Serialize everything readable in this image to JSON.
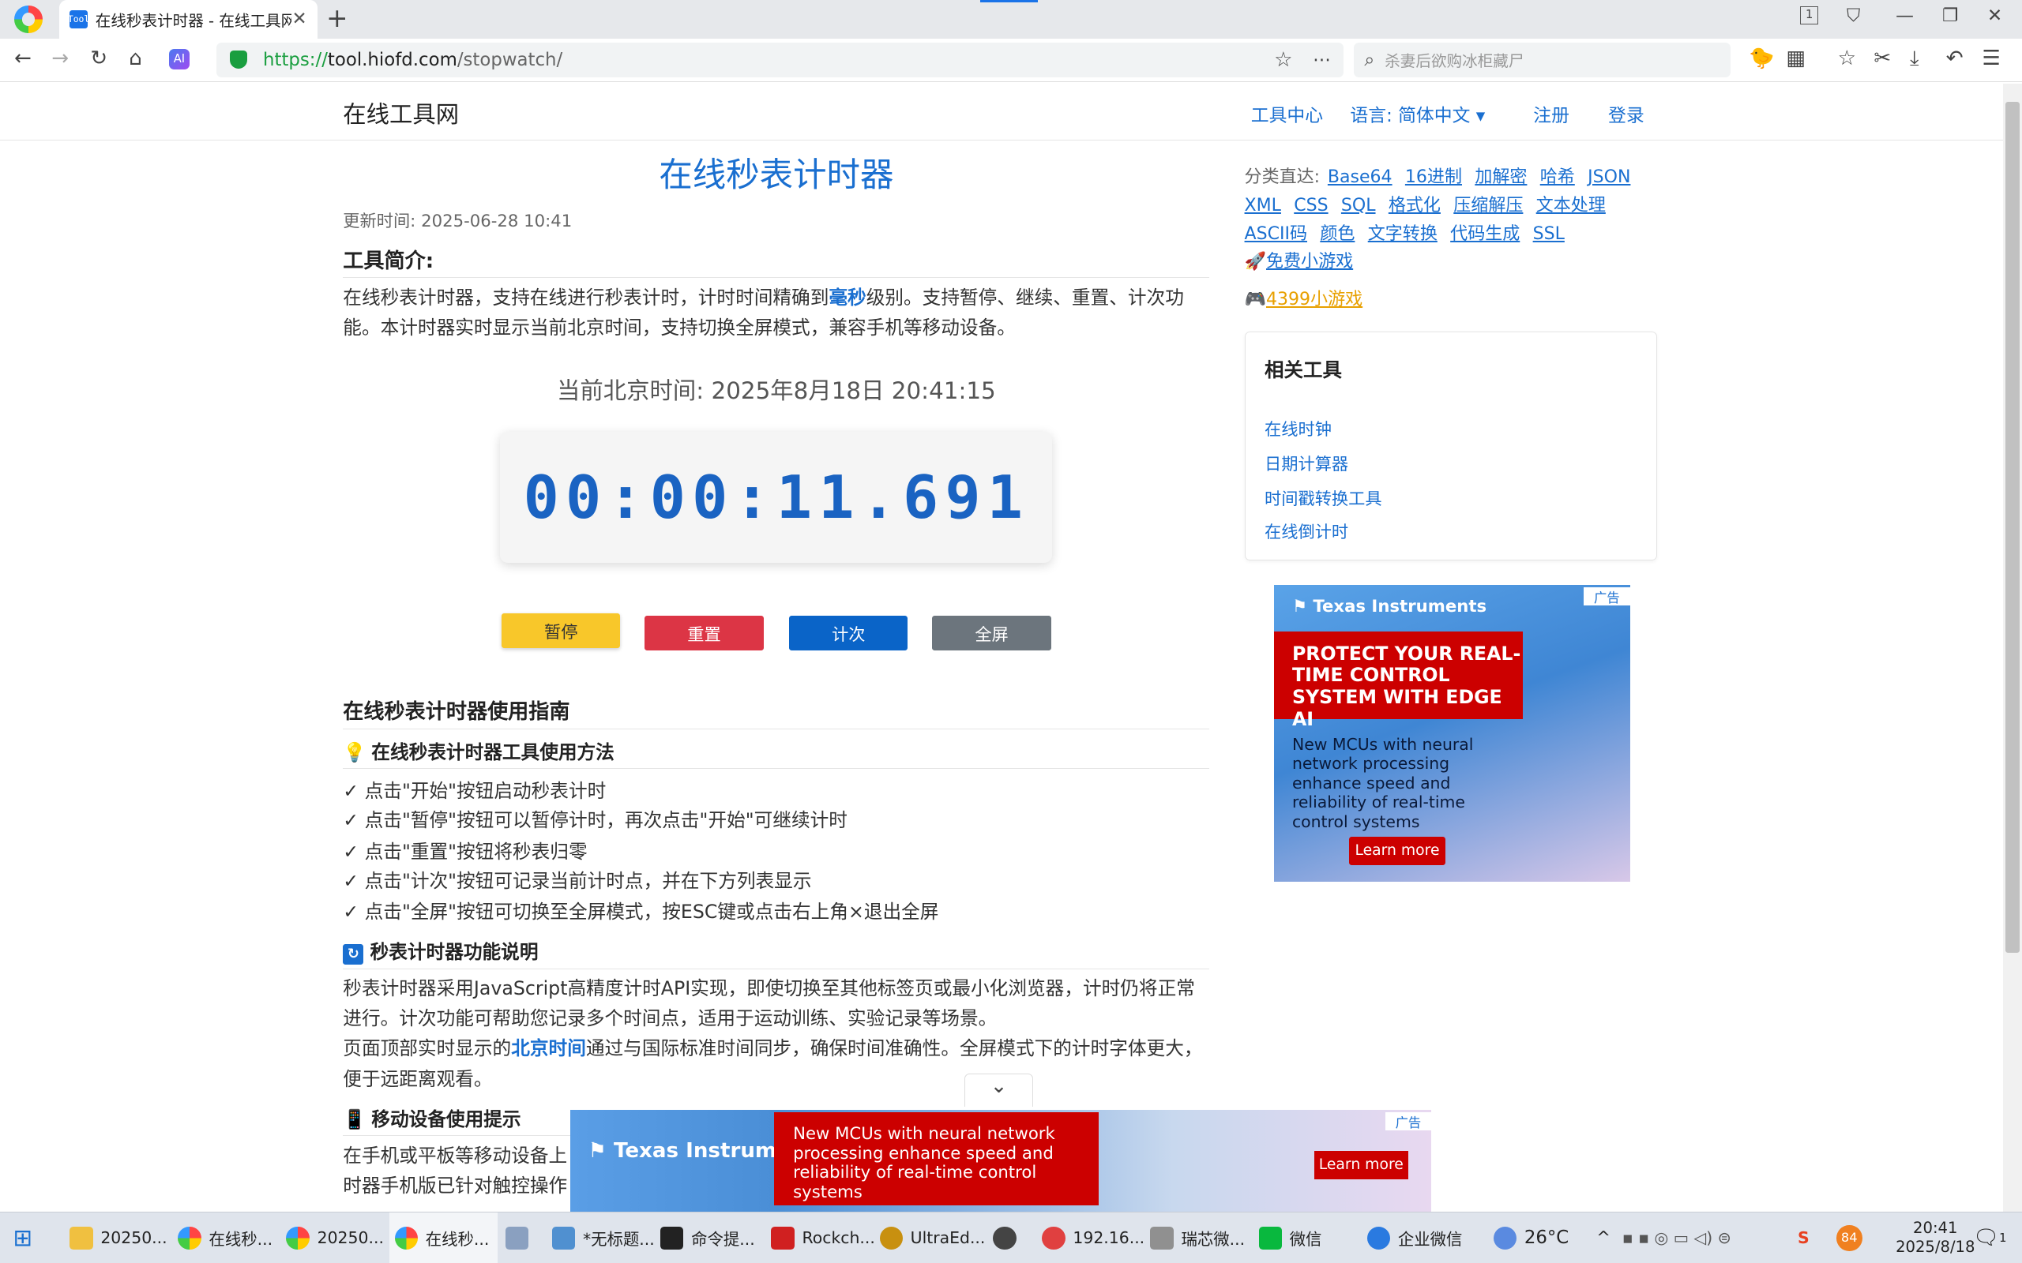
{
  "browser": {
    "tab_title": "在线秒表计时器 - 在线工具网",
    "tab_favicon": "Tool",
    "url_scheme": "https://",
    "url_host": "tool.hiofd.com",
    "url_path": "/stopwatch/",
    "search_placeholder": "杀妻后欲购冰柜藏尸",
    "tab_count": "1"
  },
  "site": {
    "name": "在线工具网",
    "nav": [
      "工具中心",
      "语言: 简体中文 ▾",
      "注册",
      "登录"
    ]
  },
  "main": {
    "title": "在线秒表计时器",
    "updated": "更新时间: 2025-06-28 10:41",
    "intro_heading": "工具简介:",
    "intro_a": "在线秒表计时器，支持在线进行秒表计时，计时时间精确到",
    "intro_bold": "毫秒",
    "intro_b": "级别。支持暂停、继续、重置、计次功能。本计时器实时显示当前北京时间，支持切换全屏模式，兼容手机等移动设备。",
    "clock": "当前北京时间: 2025年8月18日 20:41:15",
    "timer": "00:00:11.691",
    "buttons": {
      "pause": "暂停",
      "reset": "重置",
      "lap": "计次",
      "fullscreen": "全屏"
    },
    "guide_heading": "在线秒表计时器使用指南",
    "usage_heading": "在线秒表计时器工具使用方法",
    "usage_items": [
      "点击\"开始\"按钮启动秒表计时",
      "点击\"暂停\"按钮可以暂停计时，再次点击\"开始\"可继续计时",
      "点击\"重置\"按钮将秒表归零",
      "点击\"计次\"按钮可记录当前计时点，并在下方列表显示",
      "点击\"全屏\"按钮可切换至全屏模式，按ESC键或点击右上角×退出全屏"
    ],
    "feature_heading": "秒表计时器功能说明",
    "feature_p1": "秒表计时器采用JavaScript高精度计时API实现，即使切换至其他标签页或最小化浏览器，计时仍将正常进行。计次功能可帮助您记录多个时间点，适用于运动训练、实验记录等场景。",
    "feature_p2a": "页面顶部实时显示的",
    "feature_p2_bold": "北京时间",
    "feature_p2b": "通过与国际标准时间同步，确保时间准确性。全屏模式下的计时字体更大，便于远距离观看。",
    "mobile_heading": "移动设备使用提示",
    "mobile_line1": "在手机或平板等移动设备上",
    "mobile_line2": "时器手机版已针对触控操作"
  },
  "sidebar": {
    "category_label": "分类直达:",
    "categories_row1": [
      "Base64",
      "16进制",
      "加解密",
      "哈希",
      "JSON"
    ],
    "categories_row2": [
      "XML",
      "CSS",
      "SQL",
      "格式化",
      "压缩解压",
      "文本处理"
    ],
    "categories_row3": [
      "ASCII码",
      "颜色",
      "文字转换",
      "代码生成",
      "SSL"
    ],
    "free_games": "免费小游戏",
    "games_4399": "4399小游戏",
    "related_title": "相关工具",
    "related": [
      "在线时钟",
      "日期计算器",
      "时间戳转换工具",
      "在线倒计时"
    ]
  },
  "ad_side": {
    "brand": "Texas Instruments",
    "mark": "广告",
    "headline": "PROTECT YOUR REAL-TIME CONTROL SYSTEM WITH EDGE AI",
    "body": "New MCUs with neural network processing enhance speed and reliability of real-time control systems",
    "cta": "Learn more"
  },
  "ad_bottom": {
    "brand": "Texas Instruments",
    "mark": "广告",
    "body": "New MCUs with neural network processing enhance speed and reliability of real-time control systems",
    "cta": "Learn more"
  },
  "taskbar": {
    "items": [
      "20250...",
      "在线秒...",
      "20250...",
      "在线秒...",
      "",
      "*无标题...",
      "命令提...",
      "Rockch...",
      "UltraEd...",
      "",
      "192.16...",
      "瑞芯微...",
      "微信",
      "企业微信"
    ],
    "weather": "26°C",
    "time": "20:41",
    "date": "2025/8/18",
    "battery": "84",
    "badge": "1"
  }
}
